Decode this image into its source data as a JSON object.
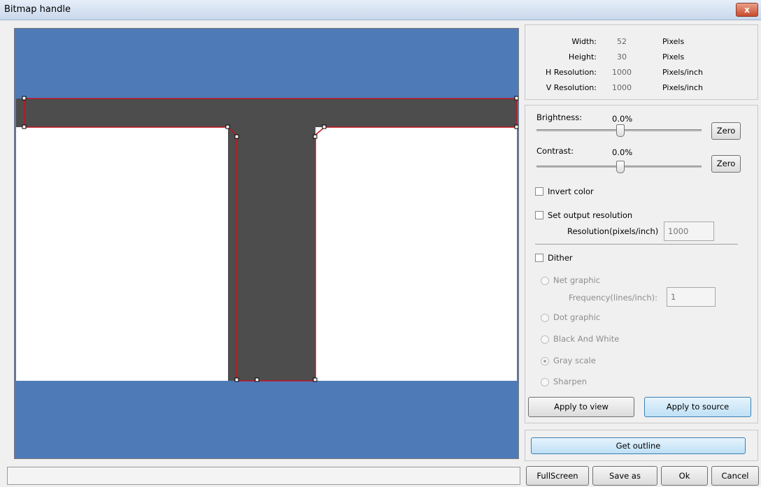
{
  "window": {
    "title": "Bitmap handle",
    "close_label": "x"
  },
  "info": [
    {
      "label": "Width:",
      "value": "52",
      "unit": "Pixels"
    },
    {
      "label": "Height:",
      "value": "30",
      "unit": "Pixels"
    },
    {
      "label": "H Resolution:",
      "value": "1000",
      "unit": "Pixels/inch"
    },
    {
      "label": "V Resolution:",
      "value": "1000",
      "unit": "Pixels/inch"
    }
  ],
  "adjust": {
    "brightness_label": "Brightness:",
    "brightness_value": "0.0%",
    "contrast_label": "Contrast:",
    "contrast_value": "0.0%",
    "zero_label": "Zero"
  },
  "options": {
    "invert_color": "Invert color",
    "set_output_resolution": "Set output resolution",
    "resolution_label": "Resolution(pixels/inch)",
    "resolution_value": "1000",
    "dither": "Dither"
  },
  "dither_modes": {
    "net_graphic": "Net graphic",
    "frequency_label": "Frequency(lines/inch):",
    "frequency_value": "1",
    "dot_graphic": "Dot graphic",
    "black_and_white": "Black And White",
    "gray_scale": "Gray scale",
    "sharpen": "Sharpen",
    "selected": "Gray scale"
  },
  "actions": {
    "apply_to_view": "Apply to view",
    "apply_to_source": "Apply to source",
    "get_outline": "Get outline"
  },
  "footer": {
    "fullscreen": "FullScreen",
    "save_as": "Save as",
    "ok": "Ok",
    "cancel": "Cancel"
  },
  "colors": {
    "canvas_background": "#4f7ab8",
    "image_background": "#ffffff",
    "shape_fill": "#4d4d4d",
    "outline": "#c0141e"
  }
}
